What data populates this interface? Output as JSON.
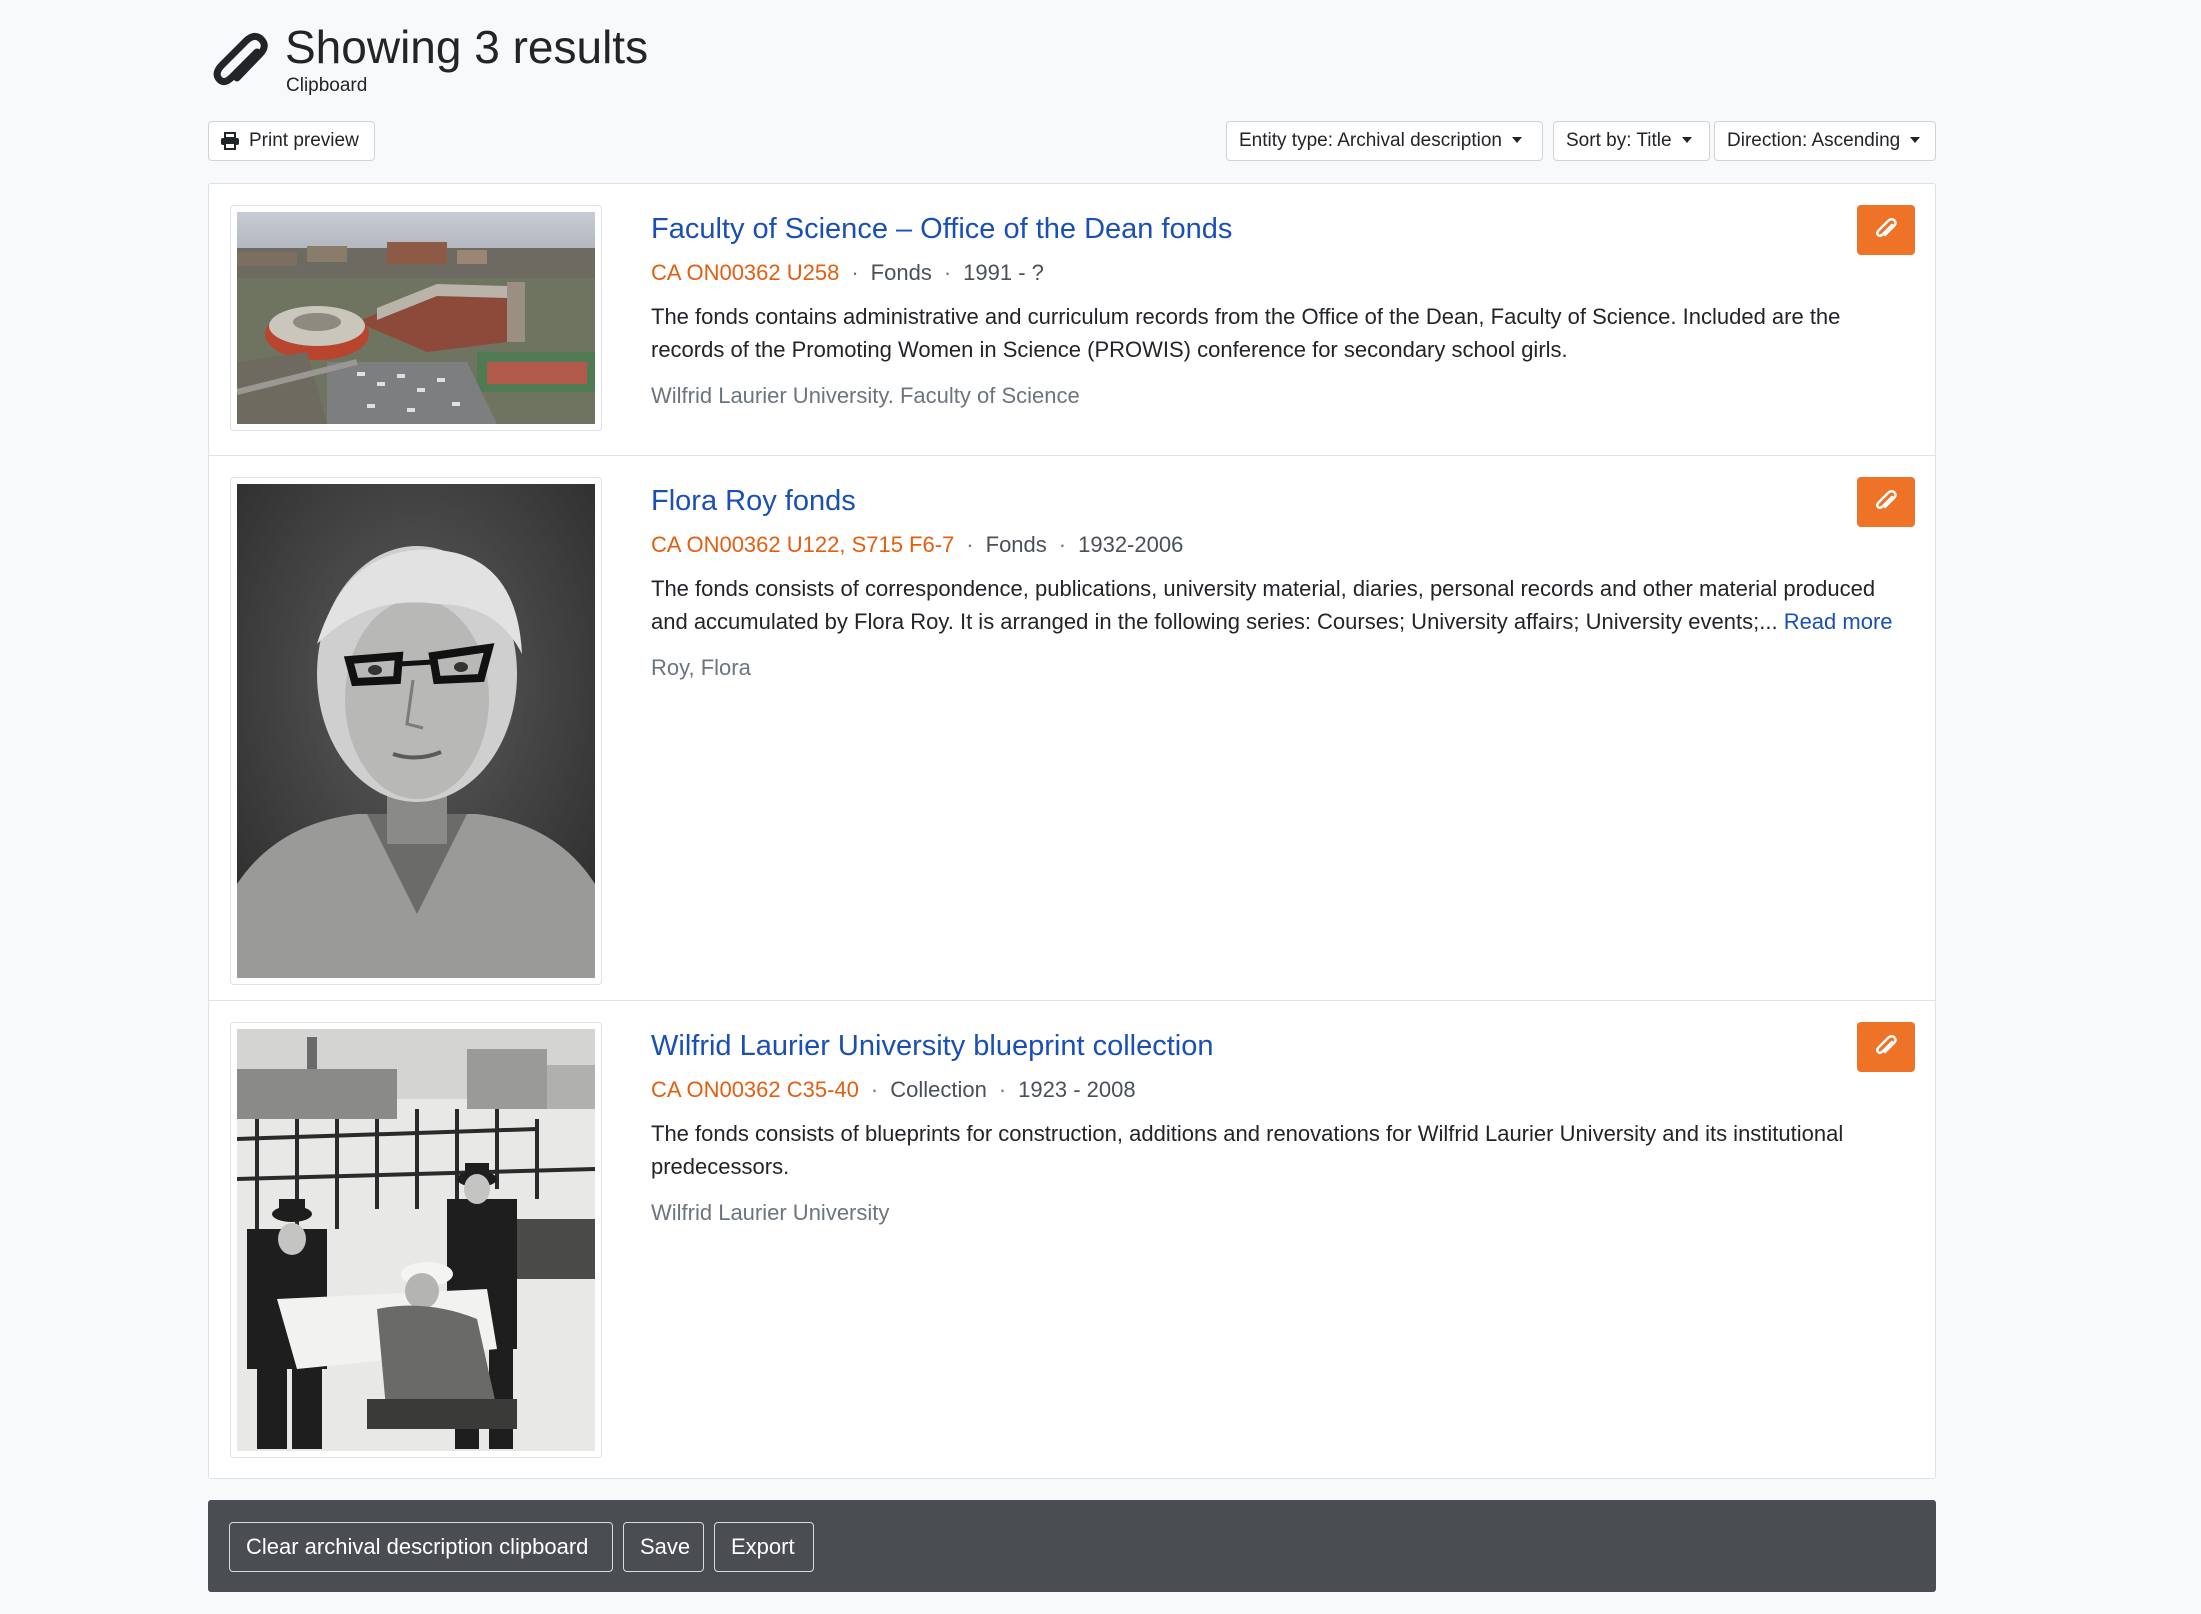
{
  "header": {
    "title": "Showing 3 results",
    "subtitle": "Clipboard",
    "icon": "paperclip-icon"
  },
  "toolbar": {
    "print_label": "Print preview",
    "entity_type_label": "Entity type: Archival description",
    "sort_label": "Sort by: Title",
    "direction_label": "Direction: Ascending"
  },
  "results": [
    {
      "title": "Faculty of Science – Office of the Dean fonds",
      "reference": "CA ON00362 U258",
      "level": "Fonds",
      "dates": "1991 - ?",
      "description": "The fonds contains administrative and curriculum records from the Office of the Dean, Faculty of Science. Included are the records of the Promoting Women in Science (PROWIS) conference for secondary school girls.",
      "creator": "Wilfrid Laurier University. Faculty of Science",
      "thumbnail": "aerial-campus-photo"
    },
    {
      "title": "Flora Roy fonds",
      "reference": "CA ON00362 U122, S715 F6-7",
      "level": "Fonds",
      "dates": "1932-2006",
      "description": "The fonds consists of correspondence, publications, university material, diaries, personal records and other material produced and accumulated by Flora Roy. It is arranged in the following series: Courses; University affairs; University events;...",
      "read_more": "Read more",
      "creator": "Roy, Flora",
      "thumbnail": "portrait-photo"
    },
    {
      "title": "Wilfrid Laurier University blueprint collection",
      "reference": "CA ON00362 C35-40",
      "level": "Collection",
      "dates": "1923 - 2008",
      "description": "The fonds consists of blueprints for construction, additions and renovations for Wilfrid Laurier University and its institutional predecessors.",
      "creator": "Wilfrid Laurier University",
      "thumbnail": "construction-site-photo"
    }
  ],
  "actions": {
    "clear_label": "Clear archival description clipboard",
    "save_label": "Save",
    "export_label": "Export"
  },
  "colors": {
    "accent": "#ef7326",
    "link": "#1a4fb8",
    "reference": "#e55d0f",
    "action_bar": "#4a4d52"
  }
}
